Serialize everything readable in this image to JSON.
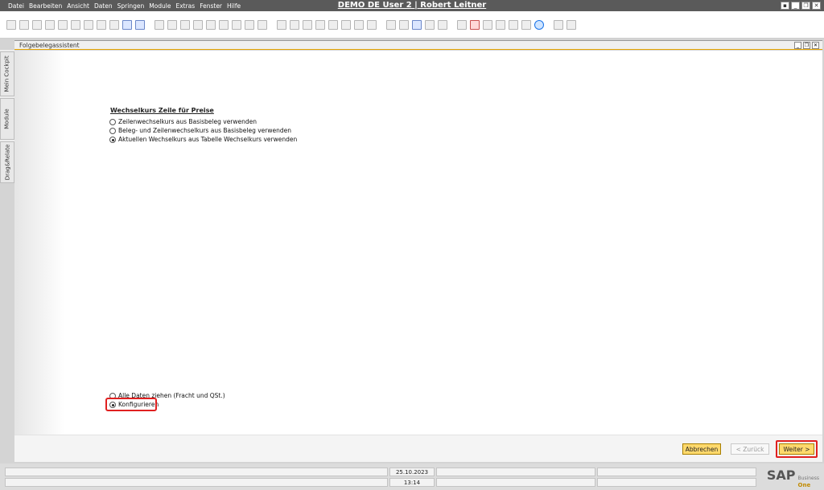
{
  "menubar": {
    "items": [
      "Datei",
      "Bearbeiten",
      "Ansicht",
      "Daten",
      "Springen",
      "Module",
      "Extras",
      "Fenster",
      "Hilfe"
    ],
    "title": "DEMO DE User 2 | Robert Leitner"
  },
  "window": {
    "title": "Folgebelegassistent"
  },
  "side_tabs": [
    "Mein Cockpit",
    "Module",
    "Drag&Relate"
  ],
  "form": {
    "section_title": "Wechselkurs Zeile für Preise",
    "exchange_options": [
      {
        "label": "Zeilenwechselkurs aus Basisbeleg verwenden",
        "selected": false
      },
      {
        "label": "Beleg- und Zeilenwechselkurs aus Basisbeleg verwenden",
        "selected": false
      },
      {
        "label": "Aktuellen Wechselkurs aus Tabelle Wechselkurs verwenden",
        "selected": true
      }
    ],
    "pull_options": [
      {
        "label": "Alle Daten ziehen (Fracht und QSt.)",
        "selected": false
      },
      {
        "label": "Konfigurieren",
        "selected": true
      }
    ]
  },
  "buttons": {
    "cancel": "Abbrechen",
    "back": "< Zurück",
    "next": "Weiter >"
  },
  "statusbar": {
    "date": "25.10.2023",
    "time": "13:14",
    "logo_text": "SAP",
    "logo_sub_top": "Business",
    "logo_sub_bottom": "One"
  }
}
